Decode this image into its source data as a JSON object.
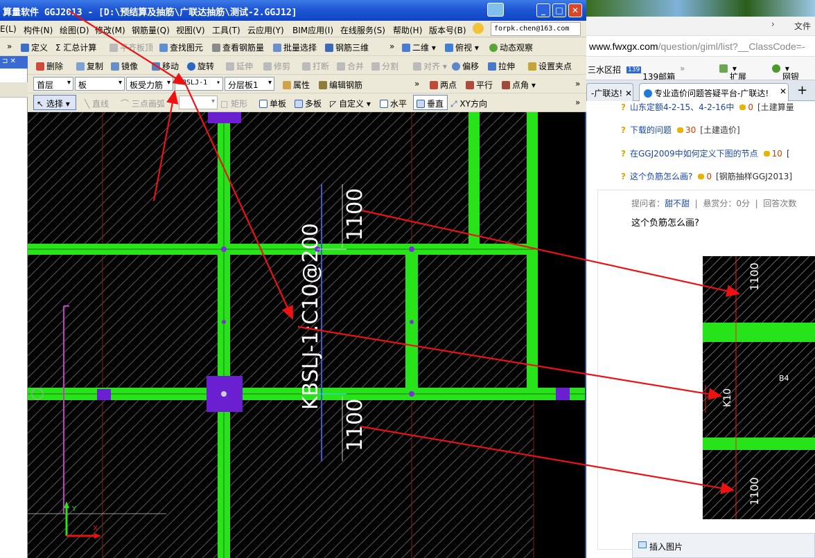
{
  "browser": {
    "menu": "文件",
    "url_prefix": "www.fwxgx.com",
    "url_rest": "/question/giml/list?__ClassCode=-",
    "bookmarks": [
      "三水区招",
      "139邮箱",
      "扩展",
      "网银"
    ],
    "tabs": [
      {
        "label": "-广联达!"
      },
      {
        "label": "专业造价问题答疑平台-广联达!"
      }
    ],
    "questions": [
      {
        "link": "山东定额4-2-15、4-2-16中",
        "points": "0",
        "tag": "[土建算量"
      },
      {
        "link": "下载的问题",
        "points": "30",
        "tag": "[土建造价]"
      },
      {
        "link": "在GGJ2009中如何定义下图的节点",
        "points": "10",
        "tag": "["
      },
      {
        "link": "这个负筋怎么画?",
        "points": "0",
        "tag": "[钢筋抽样GGJ2013]"
      }
    ],
    "detail": {
      "asker_label": "提问者：",
      "asker": "甜不甜",
      "reward": "悬赏分：0分",
      "answers": "回答次数",
      "title": "这个负筋怎么画?"
    },
    "img_labels": [
      "1100",
      "K10",
      "B4",
      "1100"
    ],
    "insert_image": "插入图片"
  },
  "app": {
    "title": "算量软件 GGJ2013 - [D:\\预结算及抽筋\\广联达抽筋\\测试-2.GGJ12]",
    "menus": [
      "E(L)",
      "构件(N)",
      "绘图(D)",
      "修改(M)",
      "钢筋量(Q)",
      "视图(V)",
      "工具(T)",
      "云应用(Y)",
      "BIM应用(I)",
      "在线服务(S)",
      "帮助(H)",
      "版本号(B)"
    ],
    "email": "forpk.chen@163.com",
    "toolbar1": [
      "定义",
      "汇总计算",
      "平齐板顶",
      "查找图元",
      "查看钢筋量",
      "批量选择",
      "钢筋三维",
      "二维",
      "俯视",
      "动态观察"
    ],
    "toolbar2": [
      "删除",
      "复制",
      "镜像",
      "移动",
      "旋转",
      "延伸",
      "修剪",
      "打断",
      "合并",
      "分割",
      "对齐",
      "偏移",
      "拉伸",
      "设置夹点"
    ],
    "toolbar3": {
      "floor": "首层",
      "category": "板",
      "type": "板受力筋",
      "name": "KBSLJ-1",
      "layer": "分层板1",
      "props": "属性",
      "edit": "编辑钢筋",
      "two_points": "两点",
      "parallel": "平行",
      "point_angle": "点角"
    },
    "toolbar4": [
      "选择",
      "直线",
      "三点画弧",
      "矩形",
      "单板",
      "多板",
      "自定义",
      "水平",
      "垂直",
      "XY方向"
    ],
    "drawing": {
      "dim_top": "1100",
      "dim_bottom": "1100",
      "rebar_label": "KBSLJ-1:C10@200",
      "axis_y": "Y",
      "axis_x": "X"
    },
    "colors": {
      "beam": "#28e21a",
      "column": "#6a1fd0",
      "hatch": "#5a5a5a",
      "arrow": "#ee1111",
      "dimension": "#3b5bd6"
    }
  }
}
